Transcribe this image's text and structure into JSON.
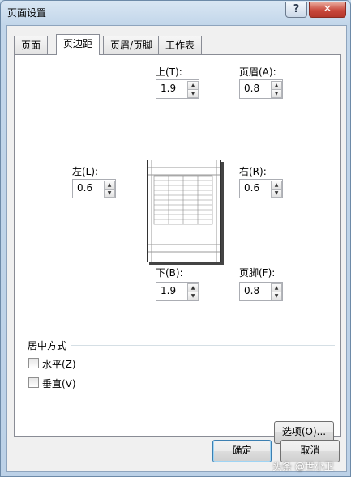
{
  "window": {
    "title": "页面设置",
    "help_glyph": "?",
    "close_glyph": "✕"
  },
  "tabs": [
    "页面",
    "页边距",
    "页眉/页脚",
    "工作表"
  ],
  "margins": {
    "top": {
      "label": "上(T):",
      "value": "1.9"
    },
    "header": {
      "label": "页眉(A):",
      "value": "0.8"
    },
    "left": {
      "label": "左(L):",
      "value": "0.6"
    },
    "right": {
      "label": "右(R):",
      "value": "0.6"
    },
    "bottom": {
      "label": "下(B):",
      "value": "1.9"
    },
    "footer": {
      "label": "页脚(F):",
      "value": "0.8"
    }
  },
  "center_on_page": {
    "group_label": "居中方式",
    "horizontal": {
      "label": "水平(Z)",
      "checked": false
    },
    "vertical": {
      "label": "垂直(V)",
      "checked": false
    }
  },
  "buttons": {
    "options": "选项(O)...",
    "ok": "确定",
    "cancel": "取消"
  },
  "watermark": "头条 @世小卫"
}
